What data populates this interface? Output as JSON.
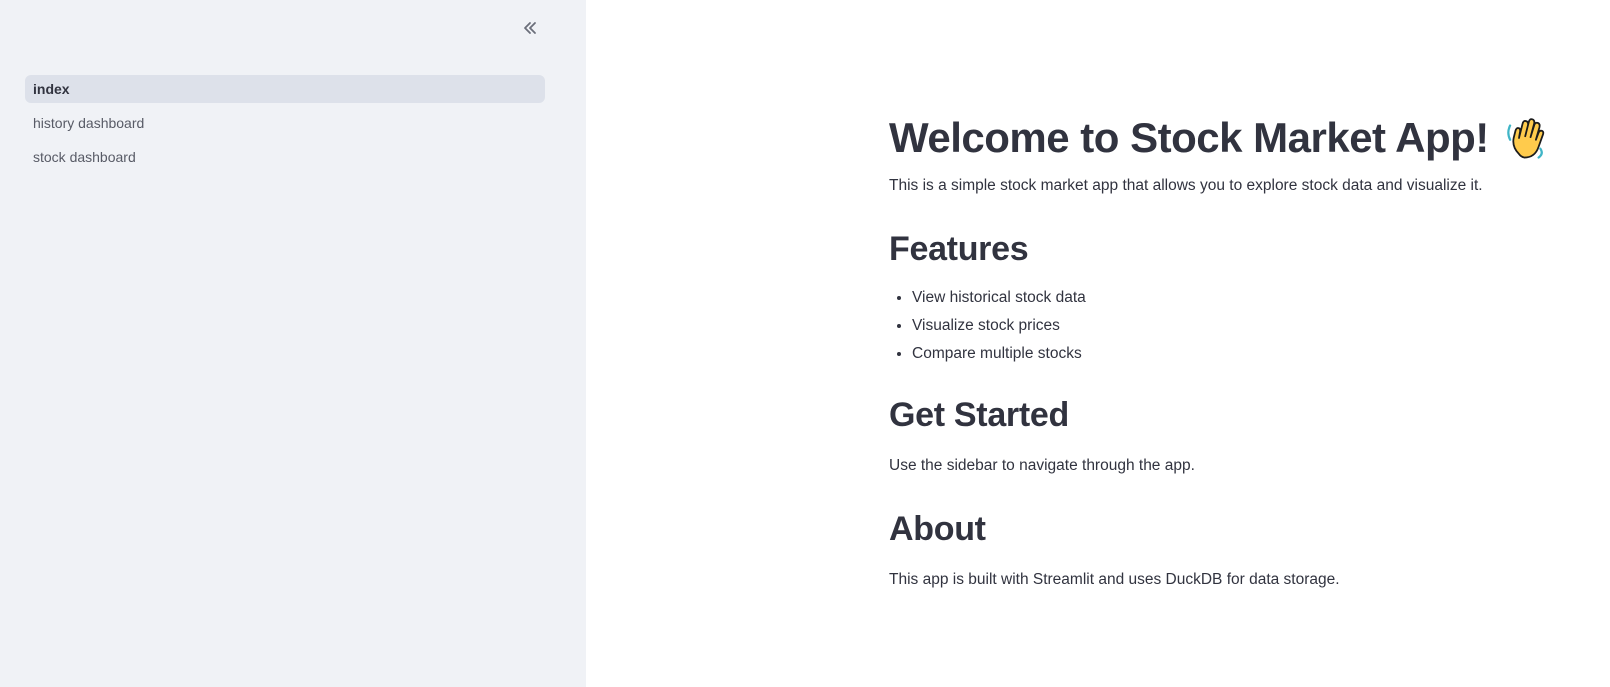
{
  "sidebar": {
    "items": [
      {
        "label": "index",
        "active": true
      },
      {
        "label": "history dashboard",
        "active": false
      },
      {
        "label": "stock dashboard",
        "active": false
      }
    ],
    "collapse_icon": "double-chevron-left-icon"
  },
  "main": {
    "title": "Welcome to Stock Market App!",
    "title_icon": "waving-hand-icon",
    "intro": "This is a simple stock market app that allows you to explore stock data and visualize it.",
    "features": {
      "heading": "Features",
      "items": [
        "View historical stock data",
        "Visualize stock prices",
        "Compare multiple stocks"
      ]
    },
    "get_started": {
      "heading": "Get Started",
      "text": "Use the sidebar to navigate through the app."
    },
    "about": {
      "heading": "About",
      "text": "This app is built with Streamlit and uses DuckDB for data storage."
    }
  },
  "colors": {
    "sidebar_bg": "#f0f2f6",
    "active_item_bg": "#dde1ea",
    "text": "#31333f",
    "muted_text": "#585b66"
  }
}
